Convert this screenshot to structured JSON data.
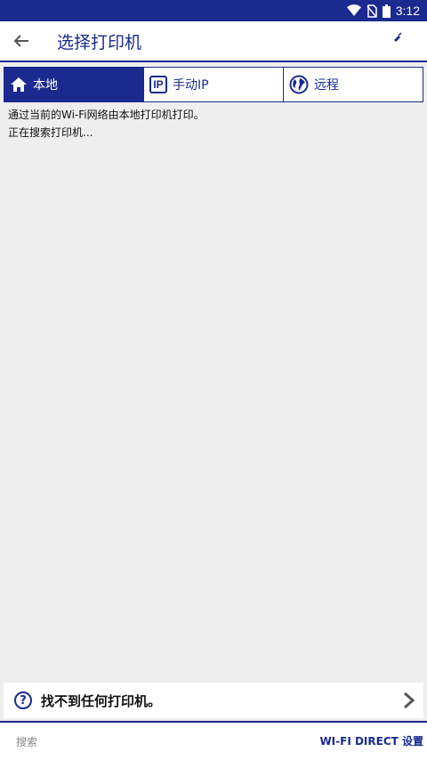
{
  "status_bar": {
    "time": "3:12",
    "icons": [
      "wifi-icon",
      "no-sim-icon",
      "battery-icon"
    ]
  },
  "app_bar": {
    "title": "选择打印机",
    "back_icon": "back-arrow-icon",
    "action_icon": "pin-icon"
  },
  "tabs": [
    {
      "label": "本地",
      "icon": "home-icon",
      "active": true
    },
    {
      "label": "手动IP",
      "icon": "ip-icon",
      "active": false
    },
    {
      "label": "远程",
      "icon": "globe-icon",
      "active": false
    }
  ],
  "ip_badge": "IP",
  "info": {
    "line1": "通过当前的Wi-Fi网络由本地打印机打印。",
    "line2": "正在搜索打印机..."
  },
  "not_found": {
    "icon_text": "?",
    "label": "找不到任何打印机。"
  },
  "bottom_bar": {
    "search_label": "搜索",
    "wifi_direct_label": "WI-FI DIRECT 设置"
  },
  "colors": {
    "accent": "#1a2a8f",
    "background": "#eeeeee"
  }
}
